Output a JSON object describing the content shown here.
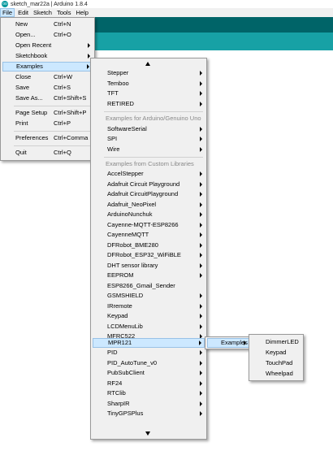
{
  "window": {
    "title": "sketch_mar22a | Arduino 1.8.4",
    "icon": "arduino-icon",
    "icon_text": "oo"
  },
  "menubar": [
    "File",
    "Edit",
    "Sketch",
    "Tools",
    "Help"
  ],
  "colors": {
    "toolbar": "#006468",
    "tabbar": "#17a1a5",
    "menu_bg": "#f0f0f0",
    "highlight": "#cce8ff"
  },
  "file_menu": {
    "new": {
      "label": "New",
      "shortcut": "Ctrl+N"
    },
    "open": {
      "label": "Open...",
      "shortcut": "Ctrl+O"
    },
    "open_recent": {
      "label": "Open Recent"
    },
    "sketchbook": {
      "label": "Sketchbook"
    },
    "examples": {
      "label": "Examples"
    },
    "close": {
      "label": "Close",
      "shortcut": "Ctrl+W"
    },
    "save": {
      "label": "Save",
      "shortcut": "Ctrl+S"
    },
    "save_as": {
      "label": "Save As...",
      "shortcut": "Ctrl+Shift+S"
    },
    "page_setup": {
      "label": "Page Setup",
      "shortcut": "Ctrl+Shift+P"
    },
    "print": {
      "label": "Print",
      "shortcut": "Ctrl+P"
    },
    "preferences": {
      "label": "Preferences",
      "shortcut": "Ctrl+Comma"
    },
    "quit": {
      "label": "Quit",
      "shortcut": "Ctrl+Q"
    }
  },
  "examples_menu": {
    "top_items": [
      "Stepper",
      "Temboo",
      "TFT",
      "RETIRED"
    ],
    "uno_header": "Examples for Arduino/Genuino Uno",
    "uno_items": [
      "SoftwareSerial",
      "SPI",
      "Wire"
    ],
    "custom_header": "Examples from Custom Libraries",
    "custom_items": [
      "AccelStepper",
      "Adafruit Circuit Playground",
      "Adafruit CircuitPlayground",
      "Adafruit_NeoPixel",
      "ArduinoNunchuk",
      "Cayenne-MQTT-ESP8266",
      "CayenneMQTT",
      "DFRobot_BME280",
      "DFRobot_ESP32_WiFiBLE",
      "DHT sensor library",
      "EEPROM",
      "ESP8266_Gmail_Sender",
      "GSMSHIELD",
      "IRremote",
      "Keypad",
      "LCDMenuLib",
      "MFRC522",
      "MPR121",
      "PID",
      "PID_AutoTune_v0",
      "PubSubClient",
      "RF24",
      "RTClib",
      "SharpIR",
      "TinyGPSPlus"
    ]
  },
  "mpr121_menu": {
    "examples": "Examples"
  },
  "mpr121_examples": [
    "DimmerLED",
    "Keypad",
    "TouchPad",
    "Wheelpad"
  ]
}
